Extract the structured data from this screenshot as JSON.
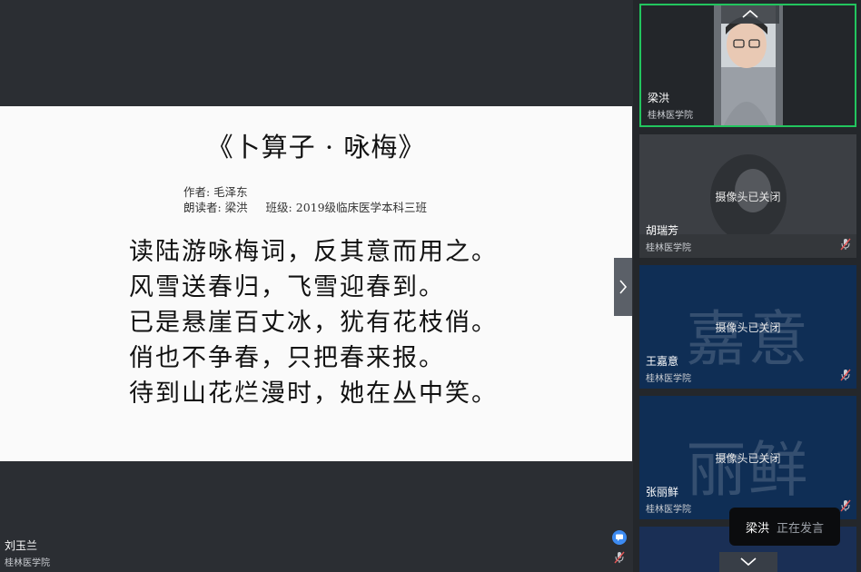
{
  "slide": {
    "title": "《卜算子 · 咏梅》",
    "author_line": "作者: 毛泽东",
    "reader_line": "朗读者: 梁洪     班级: 2019级临床医学本科三班",
    "poem_lines": [
      "读陆游咏梅词，反其意而用之。",
      "风雪送春归，飞雪迎春到。",
      "已是悬崖百丈冰，犹有花枝俏。",
      "俏也不争春，只把春来报。",
      "待到山花烂漫时，她在丛中笑。"
    ]
  },
  "presenter": {
    "name": "刘玉兰",
    "org": "桂林医学院"
  },
  "participants": [
    {
      "name": "梁洪",
      "org": "桂林医学院",
      "camera_on": true,
      "active_speaker": true
    },
    {
      "name": "胡瑞芳",
      "org": "桂林医学院",
      "camera_status": "摄像头已关闭",
      "muted": true
    },
    {
      "name": "王嘉意",
      "org": "桂林医学院",
      "camera_status": "摄像头已关闭",
      "placeholder_name": "嘉意",
      "muted": true
    },
    {
      "name": "张丽鲜",
      "org": "桂林医学院",
      "camera_status": "摄像头已关闭",
      "placeholder_name": "丽鲜",
      "muted": true
    }
  ],
  "speaking_toast": {
    "name": "梁洪",
    "status": "正在发言"
  },
  "colors": {
    "background": "#2b2e33",
    "sidebar": "#24272b",
    "active_speaker_border": "#22c55e",
    "tile_blue": "#0f2e55",
    "chat_blue": "#3d8bf2"
  },
  "icons": [
    "chevron-up-icon",
    "chevron-down-icon",
    "chevron-right-icon",
    "chat-icon",
    "mic-off-icon"
  ]
}
